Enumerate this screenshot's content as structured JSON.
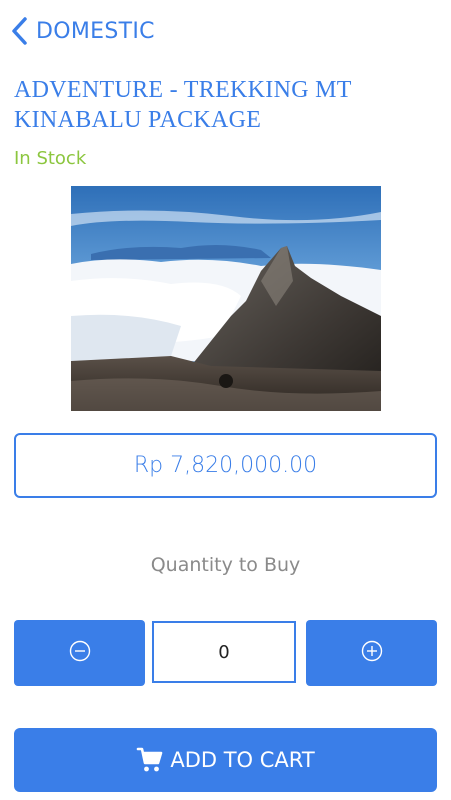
{
  "header": {
    "back_icon": "chevron-left-icon",
    "back_label": "DOMESTIC"
  },
  "product": {
    "title": "ADVENTURE - TREKKING MT KINABALU PACKAGE",
    "stock_status": "In Stock",
    "price": "Rp 7,820,000.00"
  },
  "quantity": {
    "label": "Quantity to Buy",
    "value": "0",
    "decrement_icon": "minus-circle-icon",
    "increment_icon": "plus-circle-icon"
  },
  "cart": {
    "button_label": "ADD TO CART",
    "icon": "shopping-cart-icon"
  },
  "colors": {
    "accent": "#3a7ee8",
    "in_stock": "#8cc63f",
    "muted_text": "#8a8a8a"
  }
}
